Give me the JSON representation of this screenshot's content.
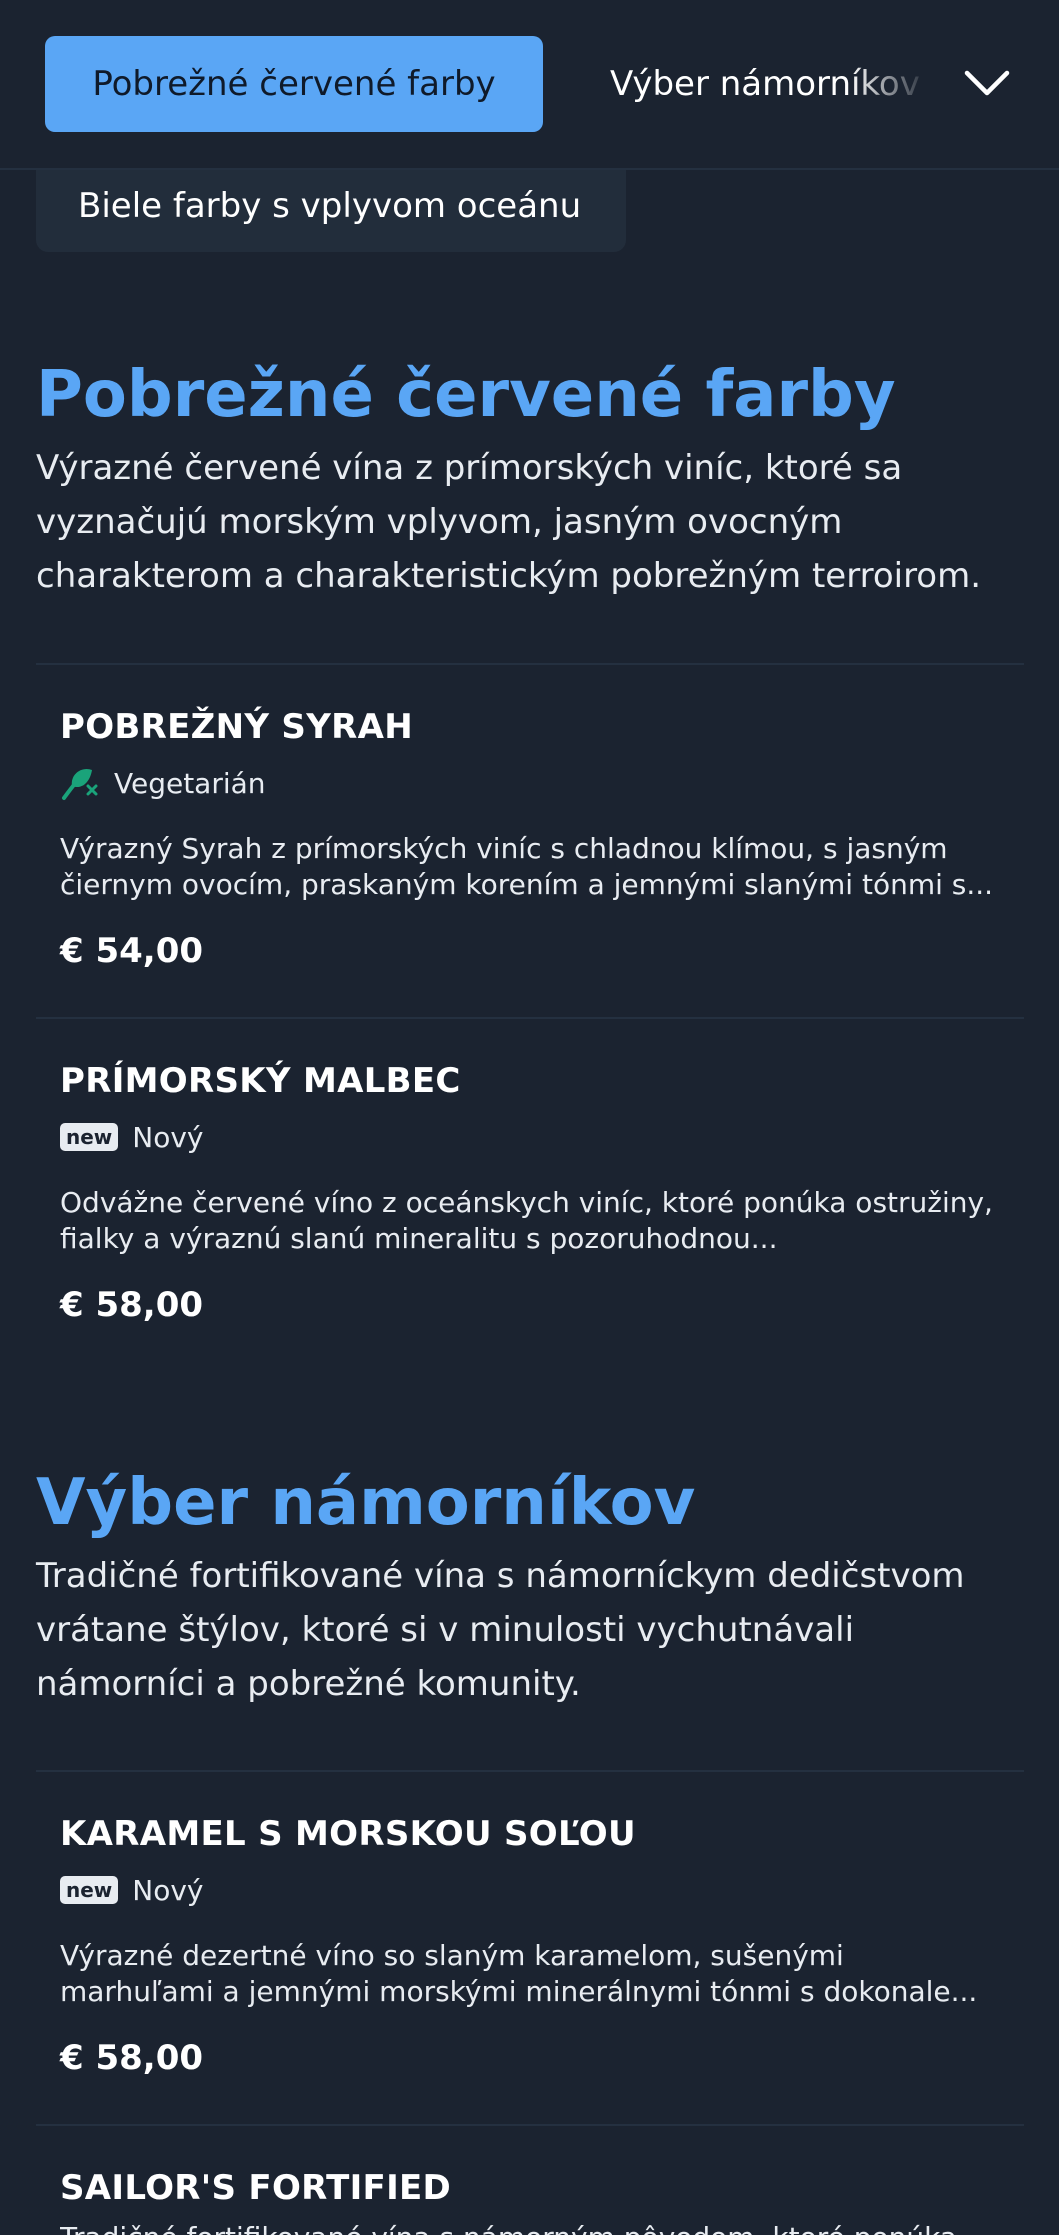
{
  "nav": {
    "active_tab": "Pobrežné červené farby",
    "next_tab": "Výber námorníkov",
    "peek_tab": "Biele farby s vplyvom oceánu"
  },
  "sections": [
    {
      "title": "Pobrežné červené farby",
      "description": "Výrazné červené vína z prímorských viníc, ktoré sa vyznačujú morským vplyvom, jasným ovocným charakterom a charakteristickým pobrežným terroirom.",
      "items": [
        {
          "name": "POBREŽNÝ SYRAH",
          "badge_label": "Vegetarián",
          "badge_icon": "leaf-icon",
          "description": "Výrazný Syrah z prímorských viníc s chladnou klímou, s jasným čiernym ovocím, praskaným korením a jemnými slanými tónmi s...",
          "price": "€ 54,00"
        },
        {
          "name": "PRÍMORSKÝ MALBEC",
          "badge_tag": "new",
          "badge_label": "Nový",
          "description": "Odvážne červené víno z oceánskych viníc, ktoré ponúka ostružiny, fialky a výraznú slanú mineralitu s pozoruhodnou...",
          "price": "€ 58,00"
        }
      ]
    },
    {
      "title": "Výber námorníkov",
      "description": "Tradičné fortifikované vína s námorníckym dedičstvom vrátane štýlov, ktoré si v minulosti vychutnávali námorníci a pobrežné komunity.",
      "items": [
        {
          "name": "KARAMEL S MORSKOU SOĽOU",
          "badge_tag": "new",
          "badge_label": "Nový",
          "description": "Výrazné dezertné víno so slaným karamelom, sušenými marhuľami a jemnými morskými minerálnymi tónmi s dokonale...",
          "price": "€ 58,00"
        },
        {
          "name": "SAILOR'S FORTIFIED",
          "description": "Tradičné fortifikované vína s námorným pôvodom, ktoré ponúka..."
        }
      ]
    }
  ],
  "colors": {
    "background": "#1b2330",
    "accent": "#5aa6f5",
    "divider": "#243040",
    "leaf": "#1aa37a"
  }
}
